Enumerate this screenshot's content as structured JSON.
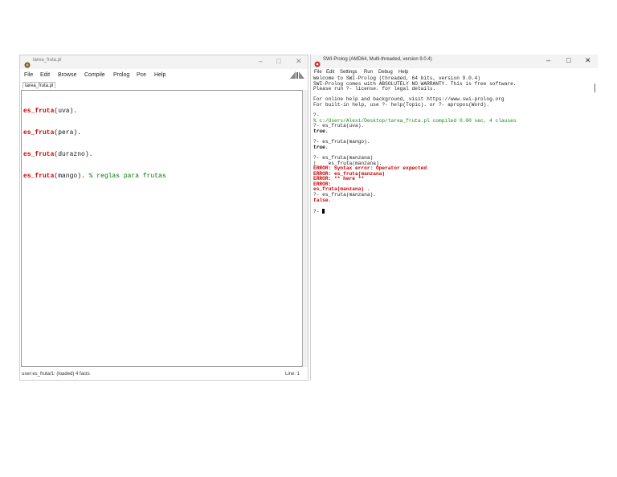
{
  "editor": {
    "title": "tarea_fruta.pl",
    "menu": [
      "File",
      "Edit",
      "Browse",
      "Compile",
      "Prolog",
      "Pce",
      "Help"
    ],
    "tab": "tarea_fruta.pl",
    "lines": [
      {
        "kw": "es_fruta",
        "rest": "(uva)."
      },
      {
        "kw": "es_fruta",
        "rest": "(pera)."
      },
      {
        "kw": "es_fruta",
        "rest": "(durazno)."
      },
      {
        "kw": "es_fruta",
        "rest": "(mango).",
        "comment": "% reglas para frutas"
      }
    ],
    "status_left": "user:es_fruta/1: (loaded) 4 facts",
    "status_right": "Line: 1"
  },
  "console": {
    "title": "SWI-Prolog (AMD64, Multi-threaded, version 9.0.4)",
    "menu": [
      "File",
      "Edit",
      "Settings",
      "Run",
      "Debug",
      "Help"
    ],
    "lines": [
      {
        "t": "Welcome to SWI-Prolog (threaded, 64 bits, version 9.0.4)",
        "s": "plain"
      },
      {
        "t": "SWI-Prolog comes with ABSOLUTELY NO WARRANTY. This is free software.",
        "s": "plain"
      },
      {
        "t": "Please run ?- license. for legal details.",
        "s": "plain"
      },
      {
        "t": "",
        "s": "plain"
      },
      {
        "t": "For online help and background, visit https://www.swi-prolog.org",
        "s": "plain"
      },
      {
        "t": "For built-in help, use ?- help(Topic). or ?- apropos(Word).",
        "s": "plain"
      },
      {
        "t": "",
        "s": "plain"
      },
      {
        "t": "?-",
        "s": "plain"
      },
      {
        "t": "% c:/Users/Alexi/Desktop/tarea_fruta.pl compiled 0.00 sec, 4 clauses",
        "s": "green"
      },
      {
        "t": "?- es_fruta(uva).",
        "s": "plain"
      },
      {
        "t": "true.",
        "s": "bold"
      },
      {
        "t": "",
        "s": "plain"
      },
      {
        "t": "?- es_fruta(mango).",
        "s": "plain"
      },
      {
        "t": "true.",
        "s": "bold"
      },
      {
        "t": "",
        "s": "plain"
      },
      {
        "t": "?- es_fruta(manzana)",
        "s": "plain"
      },
      {
        "t": "|    es_fruta(manzana).",
        "s": "plain"
      },
      {
        "t": "ERROR: Syntax error: Operator expected",
        "s": "red"
      },
      {
        "t": "ERROR: es_fruta(manzana)",
        "s": "red"
      },
      {
        "t": "ERROR: ** here **",
        "s": "red"
      },
      {
        "t": "ERROR:",
        "s": "red"
      },
      {
        "t": "es_fruta(manzana) .",
        "s": "red"
      },
      {
        "t": "?- es_fruta(manzana).",
        "s": "plain"
      },
      {
        "t": "false.",
        "s": "red"
      },
      {
        "t": "",
        "s": "plain"
      }
    ],
    "prompt": "?- "
  }
}
